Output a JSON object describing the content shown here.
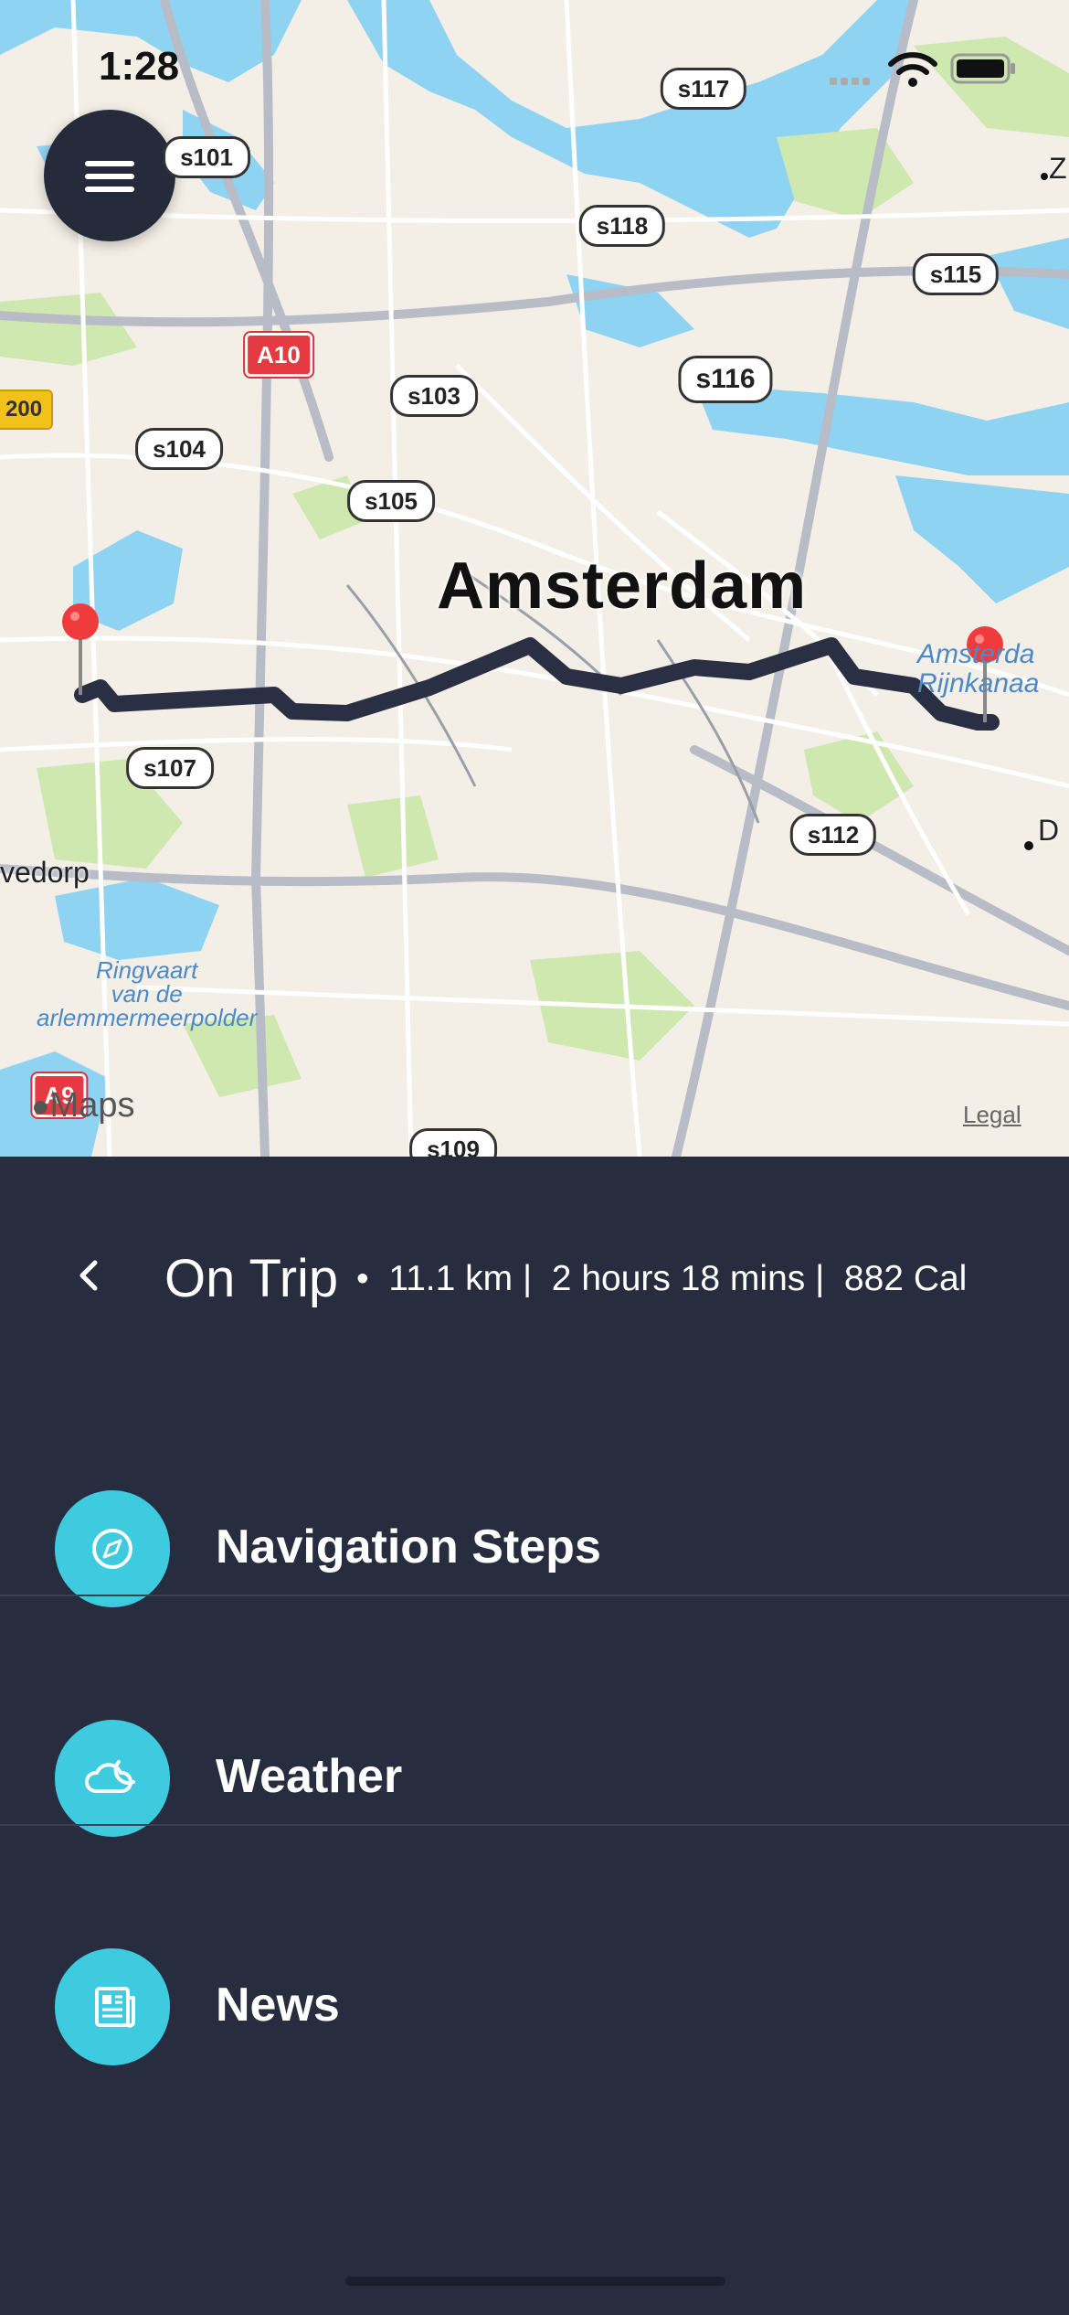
{
  "status_bar": {
    "time": "1:28"
  },
  "map": {
    "city_label": "Amsterdam",
    "place_labels": [
      "vedorp",
      "Z",
      "D"
    ],
    "water_labels": {
      "ringvaart": "Ringvaart\nvan de\narlemmermeerpolder",
      "rijnkanaal": "Amsterda\nRijnkanaa"
    },
    "route_badges": [
      "s101",
      "s117",
      "s118",
      "s115",
      "s116",
      "s103",
      "s104",
      "s105",
      "s107",
      "s112",
      "s109"
    ],
    "highway_badges": [
      "A10",
      "A9"
    ],
    "yellow_badge": "200",
    "maps_logo": "Maps",
    "legal": "Legal"
  },
  "trip": {
    "title": "On Trip",
    "stats": "•  11.1 km |  2 hours 18 mins |  882 Cal"
  },
  "menu": [
    {
      "label": "Navigation Steps",
      "icon": "compass-icon"
    },
    {
      "label": "Weather",
      "icon": "cloud-moon-icon"
    },
    {
      "label": "News",
      "icon": "newspaper-icon"
    }
  ],
  "colors": {
    "panel": "#272c3f",
    "accent": "#3ecadf",
    "route": "#2b2f44",
    "water": "#8fd3f2"
  }
}
